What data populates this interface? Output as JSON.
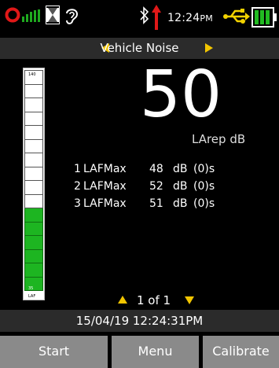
{
  "status_bar": {
    "time": "12:24",
    "ampm": "PM",
    "icons": [
      "record-icon",
      "signal-bars-icon",
      "hourglass-icon",
      "ear-icon",
      "bluetooth-icon",
      "upload-arrow-icon",
      "usb-icon",
      "battery-icon"
    ],
    "colors": {
      "record": "#e01818",
      "signal": "#1faa1f",
      "arrow": "#e01818",
      "usb": "#f2d200",
      "battery": "#22bb22"
    }
  },
  "title_bar": {
    "title": "Vehicle Noise",
    "accent": "#f2c500"
  },
  "level_meter": {
    "top_label": "140",
    "bottom_label": "35",
    "unit_label": "LAF",
    "segments_total": 16,
    "segments_lit": 6,
    "lit_color": "#1db521"
  },
  "main_reading": {
    "value": "50",
    "unit": "LArep dB"
  },
  "lafmax_rows": [
    {
      "index": "1",
      "name": "LAFMax",
      "value": "48",
      "unit": "dB",
      "duration": "(0)s"
    },
    {
      "index": "2",
      "name": "LAFMax",
      "value": "52",
      "unit": "dB",
      "duration": "(0)s"
    },
    {
      "index": "3",
      "name": "LAFMax",
      "value": "51",
      "unit": "dB",
      "duration": "(0)s"
    }
  ],
  "pager": {
    "text": "1 of 1"
  },
  "datetime": "15/04/19 12:24:31PM",
  "softkeys": {
    "start": "Start",
    "menu": "Menu",
    "calibrate": "Calibrate"
  }
}
